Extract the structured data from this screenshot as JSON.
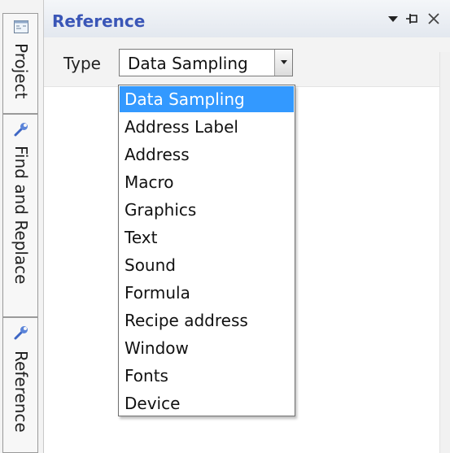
{
  "sidebar": {
    "tabs": [
      {
        "label": "Project",
        "icon": "project-icon"
      },
      {
        "label": "Find and Replace",
        "icon": "wrench-icon"
      },
      {
        "label": "Reference",
        "icon": "wrench-icon"
      }
    ]
  },
  "panel": {
    "title": "Reference",
    "buttons": {
      "dropdown": "dropdown-arrow-icon",
      "pin": "pin-icon",
      "close": "close-icon"
    }
  },
  "toolbar": {
    "type_label": "Type",
    "type_value": "Data Sampling"
  },
  "dropdown": {
    "selected": "Data Sampling",
    "options": [
      "Data Sampling",
      "Address Label",
      "Address",
      "Macro",
      "Graphics",
      "Text",
      "Sound",
      "Formula",
      "Recipe address",
      "Window",
      "Fonts",
      "Device"
    ]
  },
  "colors": {
    "title": "#3a56b7",
    "selection": "#3399ff"
  }
}
